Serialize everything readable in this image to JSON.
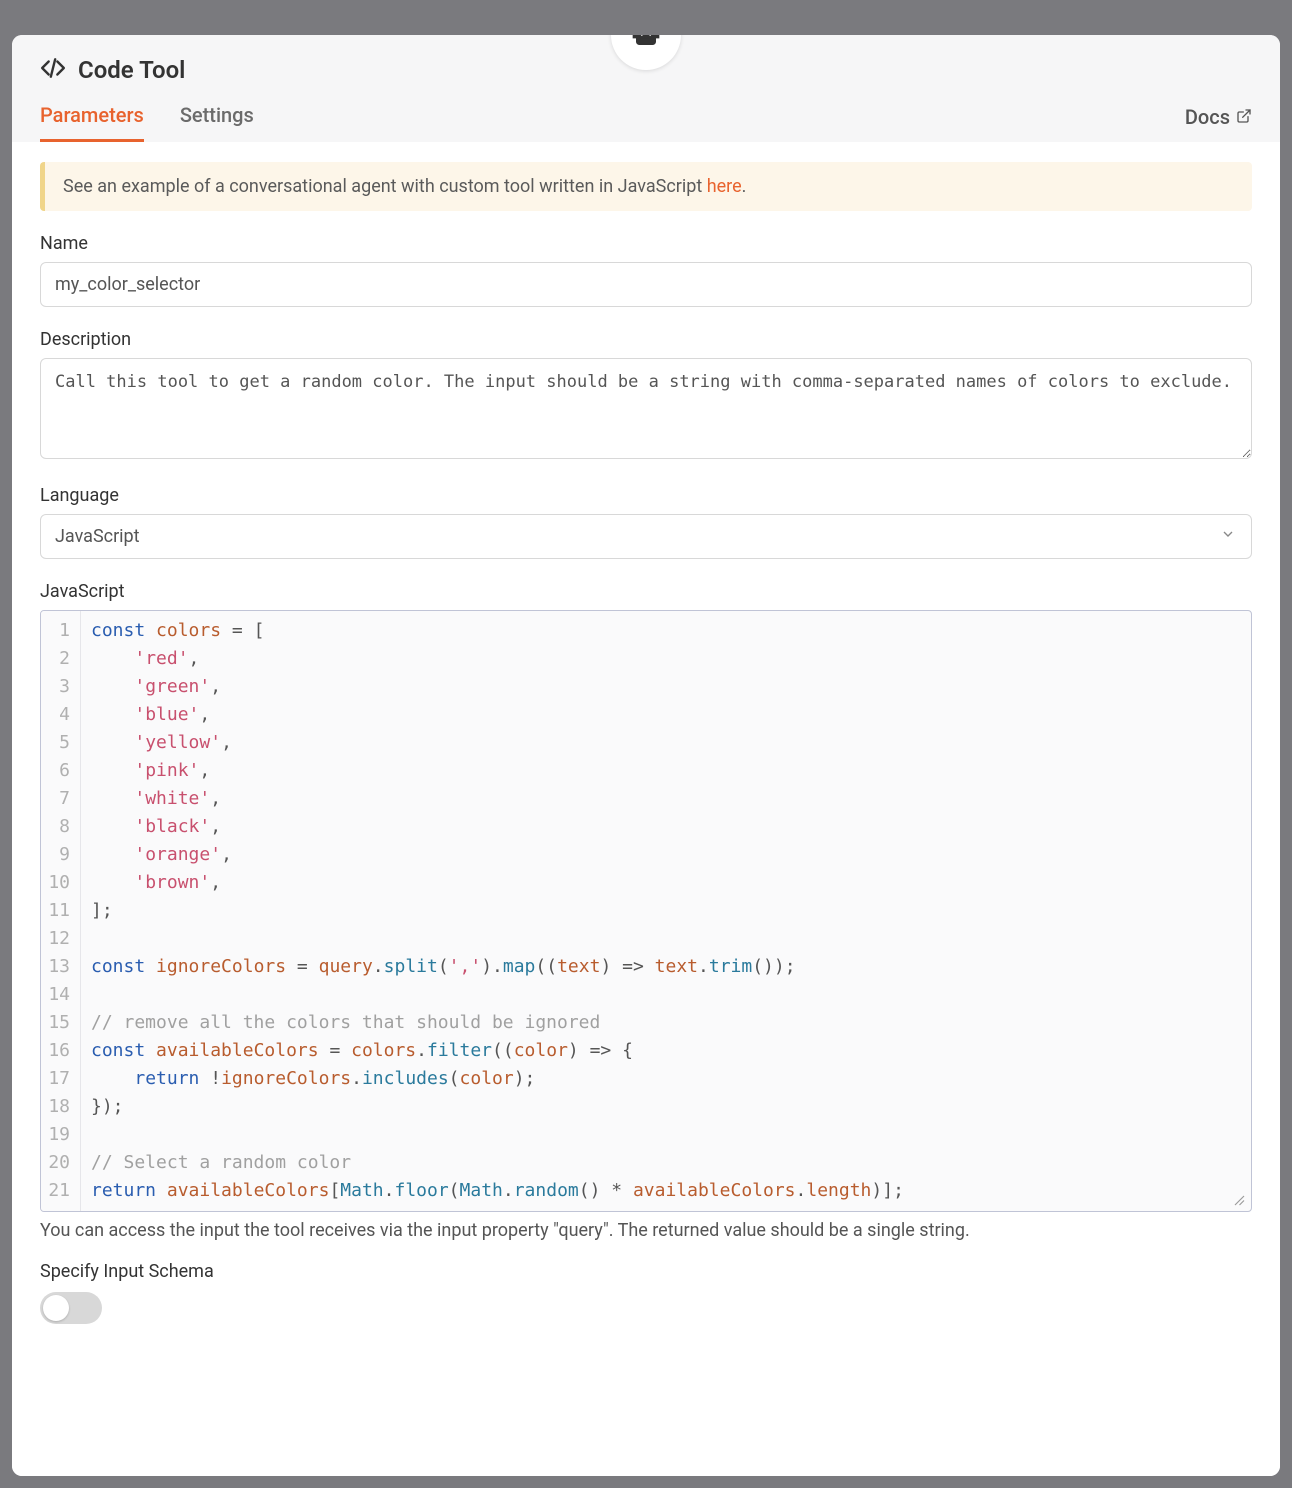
{
  "header": {
    "title": "Code Tool"
  },
  "tabs": {
    "parameters": "Parameters",
    "settings": "Settings",
    "docs": "Docs"
  },
  "banner": {
    "prefix": "See an example of a conversational agent with custom tool written in JavaScript ",
    "link": "here",
    "suffix": "."
  },
  "fields": {
    "name_label": "Name",
    "name_value": "my_color_selector",
    "description_label": "Description",
    "description_value": "Call this tool to get a random color. The input should be a string with comma-separated names of colors to exclude.",
    "language_label": "Language",
    "language_value": "JavaScript",
    "code_label": "JavaScript",
    "helper_text": "You can access the input the tool receives via the input property \"query\". The returned value should be a single string.",
    "schema_label": "Specify Input Schema"
  },
  "code": {
    "line_numbers": [
      "1",
      "2",
      "3",
      "4",
      "5",
      "6",
      "7",
      "8",
      "9",
      "10",
      "11",
      "12",
      "13",
      "14",
      "15",
      "16",
      "17",
      "18",
      "19",
      "20",
      "21"
    ],
    "lines": [
      {
        "t": [
          [
            "kw",
            "const"
          ],
          [
            "plain",
            " "
          ],
          [
            "var",
            "colors"
          ],
          [
            "plain",
            " "
          ],
          [
            "op",
            "="
          ],
          [
            "plain",
            " "
          ],
          [
            "punc",
            "["
          ]
        ]
      },
      {
        "t": [
          [
            "plain",
            "    "
          ],
          [
            "str",
            "'red'"
          ],
          [
            "punc",
            ","
          ]
        ]
      },
      {
        "t": [
          [
            "plain",
            "    "
          ],
          [
            "str",
            "'green'"
          ],
          [
            "punc",
            ","
          ]
        ]
      },
      {
        "t": [
          [
            "plain",
            "    "
          ],
          [
            "str",
            "'blue'"
          ],
          [
            "punc",
            ","
          ]
        ]
      },
      {
        "t": [
          [
            "plain",
            "    "
          ],
          [
            "str",
            "'yellow'"
          ],
          [
            "punc",
            ","
          ]
        ]
      },
      {
        "t": [
          [
            "plain",
            "    "
          ],
          [
            "str",
            "'pink'"
          ],
          [
            "punc",
            ","
          ]
        ]
      },
      {
        "t": [
          [
            "plain",
            "    "
          ],
          [
            "str",
            "'white'"
          ],
          [
            "punc",
            ","
          ]
        ]
      },
      {
        "t": [
          [
            "plain",
            "    "
          ],
          [
            "str",
            "'black'"
          ],
          [
            "punc",
            ","
          ]
        ]
      },
      {
        "t": [
          [
            "plain",
            "    "
          ],
          [
            "str",
            "'orange'"
          ],
          [
            "punc",
            ","
          ]
        ]
      },
      {
        "t": [
          [
            "plain",
            "    "
          ],
          [
            "str",
            "'brown'"
          ],
          [
            "punc",
            ","
          ]
        ]
      },
      {
        "t": [
          [
            "punc",
            "];"
          ]
        ]
      },
      {
        "t": [
          [
            "plain",
            ""
          ]
        ]
      },
      {
        "t": [
          [
            "kw",
            "const"
          ],
          [
            "plain",
            " "
          ],
          [
            "var",
            "ignoreColors"
          ],
          [
            "plain",
            " "
          ],
          [
            "op",
            "="
          ],
          [
            "plain",
            " "
          ],
          [
            "var",
            "query"
          ],
          [
            "punc",
            "."
          ],
          [
            "call",
            "split"
          ],
          [
            "punc",
            "("
          ],
          [
            "str",
            "','"
          ],
          [
            "punc",
            ")."
          ],
          [
            "call",
            "map"
          ],
          [
            "punc",
            "(("
          ],
          [
            "param",
            "text"
          ],
          [
            "punc",
            ") "
          ],
          [
            "op",
            "=>"
          ],
          [
            "plain",
            " "
          ],
          [
            "var",
            "text"
          ],
          [
            "punc",
            "."
          ],
          [
            "call",
            "trim"
          ],
          [
            "punc",
            "());"
          ]
        ]
      },
      {
        "t": [
          [
            "plain",
            ""
          ]
        ]
      },
      {
        "t": [
          [
            "cmt",
            "// remove all the colors that should be ignored"
          ]
        ]
      },
      {
        "t": [
          [
            "kw",
            "const"
          ],
          [
            "plain",
            " "
          ],
          [
            "var",
            "availableColors"
          ],
          [
            "plain",
            " "
          ],
          [
            "op",
            "="
          ],
          [
            "plain",
            " "
          ],
          [
            "var",
            "colors"
          ],
          [
            "punc",
            "."
          ],
          [
            "call",
            "filter"
          ],
          [
            "punc",
            "(("
          ],
          [
            "param",
            "color"
          ],
          [
            "punc",
            ") "
          ],
          [
            "op",
            "=>"
          ],
          [
            "plain",
            " "
          ],
          [
            "punc",
            "{"
          ]
        ]
      },
      {
        "t": [
          [
            "plain",
            "    "
          ],
          [
            "kw",
            "return"
          ],
          [
            "plain",
            " "
          ],
          [
            "op",
            "!"
          ],
          [
            "var",
            "ignoreColors"
          ],
          [
            "punc",
            "."
          ],
          [
            "call",
            "includes"
          ],
          [
            "punc",
            "("
          ],
          [
            "var",
            "color"
          ],
          [
            "punc",
            ");"
          ]
        ]
      },
      {
        "t": [
          [
            "punc",
            "});"
          ]
        ]
      },
      {
        "t": [
          [
            "plain",
            ""
          ]
        ]
      },
      {
        "t": [
          [
            "cmt",
            "// Select a random color"
          ]
        ]
      },
      {
        "t": [
          [
            "kw",
            "return"
          ],
          [
            "plain",
            " "
          ],
          [
            "var",
            "availableColors"
          ],
          [
            "punc",
            "["
          ],
          [
            "global",
            "Math"
          ],
          [
            "punc",
            "."
          ],
          [
            "call",
            "floor"
          ],
          [
            "punc",
            "("
          ],
          [
            "global",
            "Math"
          ],
          [
            "punc",
            "."
          ],
          [
            "call",
            "random"
          ],
          [
            "punc",
            "() "
          ],
          [
            "op",
            "*"
          ],
          [
            "plain",
            " "
          ],
          [
            "var",
            "availableColors"
          ],
          [
            "punc",
            "."
          ],
          [
            "var",
            "length"
          ],
          [
            "punc",
            ")];"
          ]
        ]
      }
    ]
  },
  "toggle": {
    "schema_on": false
  }
}
